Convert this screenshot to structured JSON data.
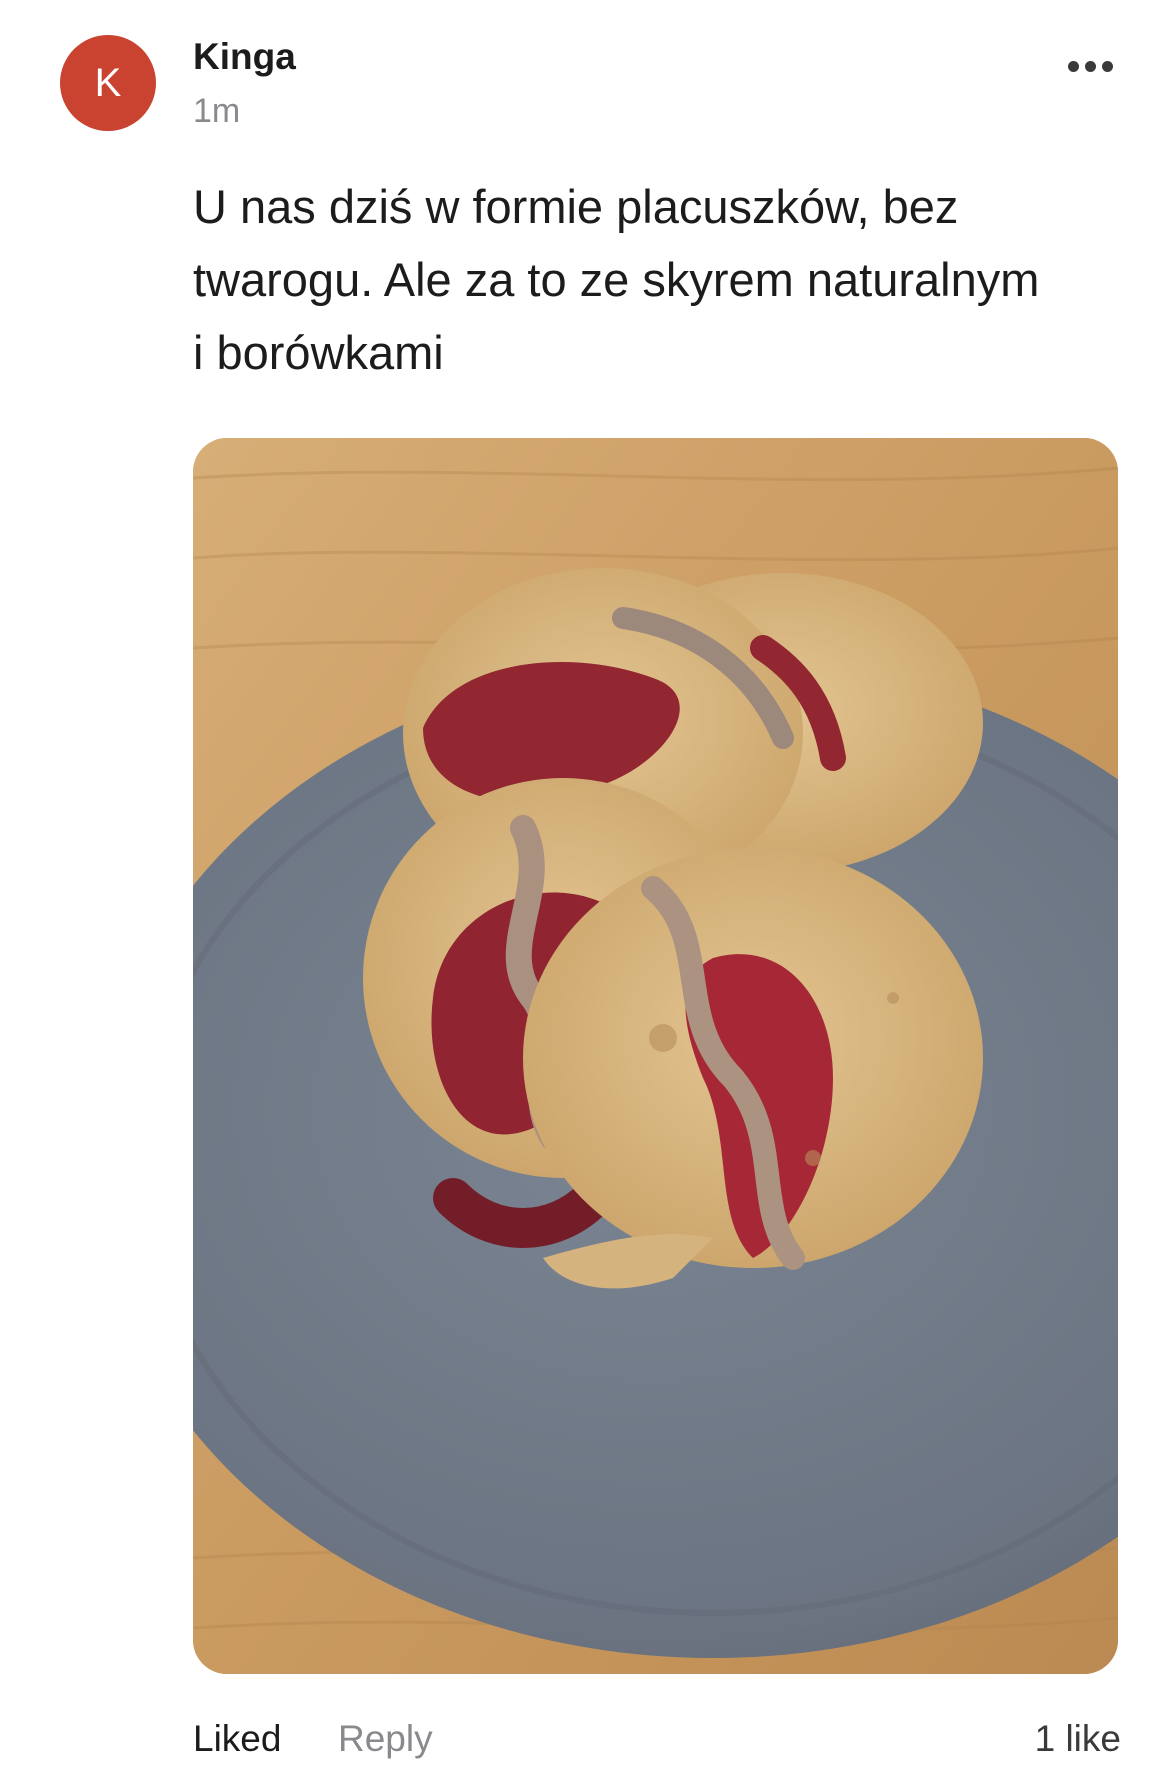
{
  "post": {
    "author": {
      "name": "Kinga",
      "avatar_initial": "K",
      "avatar_color": "#c94330"
    },
    "time": "1m",
    "more_icon": "more-horizontal-icon",
    "text": "U nas dziś w formie placuszków, bez\ntwarogu. Ale za to ze skyrem naturalnym\ni borówkami",
    "photo": {
      "subject": "pancakes with jam and nut butter on a grey plate"
    }
  },
  "actions": {
    "liked_label": "Liked",
    "reply_label": "Reply",
    "like_count": "1 like"
  }
}
